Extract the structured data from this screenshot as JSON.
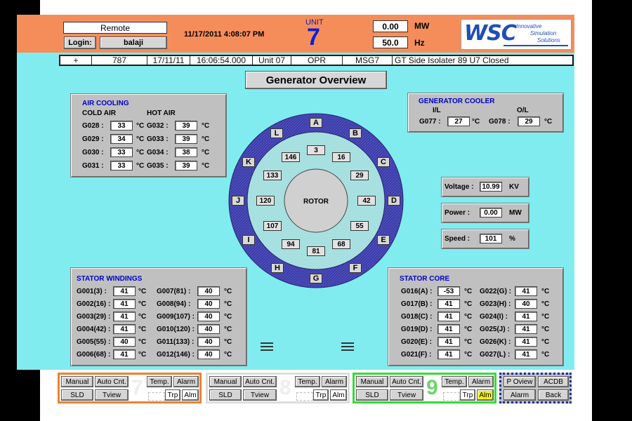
{
  "header": {
    "mode": "Remote",
    "login_label": "Login:",
    "user": "balaji",
    "datetime": "11/17/2011 4:08:07 PM",
    "unit_label": "UNIT",
    "unit_number": "7",
    "mw_value": "0.00",
    "mw_unit": "MW",
    "hz_value": "50.0",
    "hz_unit": "Hz",
    "logo_text": "WSC",
    "logo_tagline_1": "Innovative",
    "logo_tagline_2": "Simulation",
    "logo_tagline_3": "Solutions"
  },
  "alarm_bar": [
    "+",
    "787",
    "17/11/11",
    "16:06:54.000",
    "Unit 07",
    "OPR",
    "MSG7",
    "GT Side Isolater 89 U7 Closed"
  ],
  "page_title": "Generator Overview",
  "air_cooling": {
    "title": "AIR COOLING",
    "cold_header": "COLD AIR",
    "hot_header": "HOT AIR",
    "unit": "°C",
    "rows": [
      {
        "cold_label": "G028 :",
        "cold_val": "33",
        "hot_label": "G032 :",
        "hot_val": "39"
      },
      {
        "cold_label": "G029 :",
        "cold_val": "34",
        "hot_label": "G033 :",
        "hot_val": "39"
      },
      {
        "cold_label": "G030 :",
        "cold_val": "33",
        "hot_label": "G034 :",
        "hot_val": "38"
      },
      {
        "cold_label": "G031 :",
        "cold_val": "33",
        "hot_label": "G035 :",
        "hot_val": "39"
      }
    ]
  },
  "generator_cooler": {
    "title": "GENERATOR COOLER",
    "il": "I/L",
    "ol": "O/L",
    "in_label": "G077 :",
    "in_val": "27",
    "out_label": "G078 :",
    "out_val": "29",
    "unit": "°C"
  },
  "readings": {
    "voltage_label": "Voltage :",
    "voltage_val": "10.99",
    "voltage_unit": "KV",
    "power_label": "Power :",
    "power_val": "0.00",
    "power_unit": "MW",
    "speed_label": "Speed :",
    "speed_val": "101",
    "speed_unit": "%"
  },
  "rotor": {
    "label": "ROTOR",
    "outer_letters": [
      "A",
      "B",
      "C",
      "D",
      "E",
      "F",
      "G",
      "H",
      "I",
      "J",
      "K",
      "L"
    ],
    "inner_values": [
      "3",
      "16",
      "29",
      "42",
      "55",
      "68",
      "81",
      "94",
      "107",
      "120",
      "133",
      "146"
    ]
  },
  "stator_windings": {
    "title": "STATOR WINDINGS",
    "unit": "°C",
    "rows": [
      {
        "l1": "G001(3) :",
        "v1": "41",
        "l2": "G007(81) :",
        "v2": "40"
      },
      {
        "l1": "G002(16) :",
        "v1": "41",
        "l2": "G008(94) :",
        "v2": "40"
      },
      {
        "l1": "G003(29) :",
        "v1": "41",
        "l2": "G009(107) :",
        "v2": "40"
      },
      {
        "l1": "G004(42) :",
        "v1": "41",
        "l2": "G010(120) :",
        "v2": "40"
      },
      {
        "l1": "G005(55) :",
        "v1": "40",
        "l2": "G011(133) :",
        "v2": "40"
      },
      {
        "l1": "G006(68) :",
        "v1": "41",
        "l2": "G012(146) :",
        "v2": "40"
      }
    ]
  },
  "stator_core": {
    "title": "STATOR CORE",
    "unit": "°C",
    "rows": [
      {
        "l1": "G016(A) :",
        "v1": "-53",
        "l2": "G022(G) :",
        "v2": "41"
      },
      {
        "l1": "G017(B) :",
        "v1": "41",
        "l2": "G023(H) :",
        "v2": "40"
      },
      {
        "l1": "G018(C) :",
        "v1": "41",
        "l2": "G024(I) :",
        "v2": "41"
      },
      {
        "l1": "G019(D) :",
        "v1": "41",
        "l2": "G025(J) :",
        "v2": "41"
      },
      {
        "l1": "G020(E) :",
        "v1": "41",
        "l2": "G026(K) :",
        "v2": "41"
      },
      {
        "l1": "G021(F) :",
        "v1": "41",
        "l2": "G027(L) :",
        "v2": "41"
      }
    ]
  },
  "bottom": {
    "manual": "Manual",
    "auto": "Auto Cnt.",
    "temp": "Temp.",
    "alarm": "Alarm",
    "sld": "SLD",
    "tview": "Tview",
    "trp": "Trp",
    "alm": "Alm",
    "units": [
      "7",
      "8",
      "9"
    ],
    "p_oview": "P Oview",
    "acdb": "ACDB",
    "alarm2": "Alarm",
    "back": "Back"
  },
  "colors": {
    "header_orange": "#f58d5b",
    "body_cyan": "#80ecf0",
    "ring_navy": "#3a3aa8",
    "ring_light": "#a8dedd",
    "panel_gray": "#c0c0c0"
  }
}
